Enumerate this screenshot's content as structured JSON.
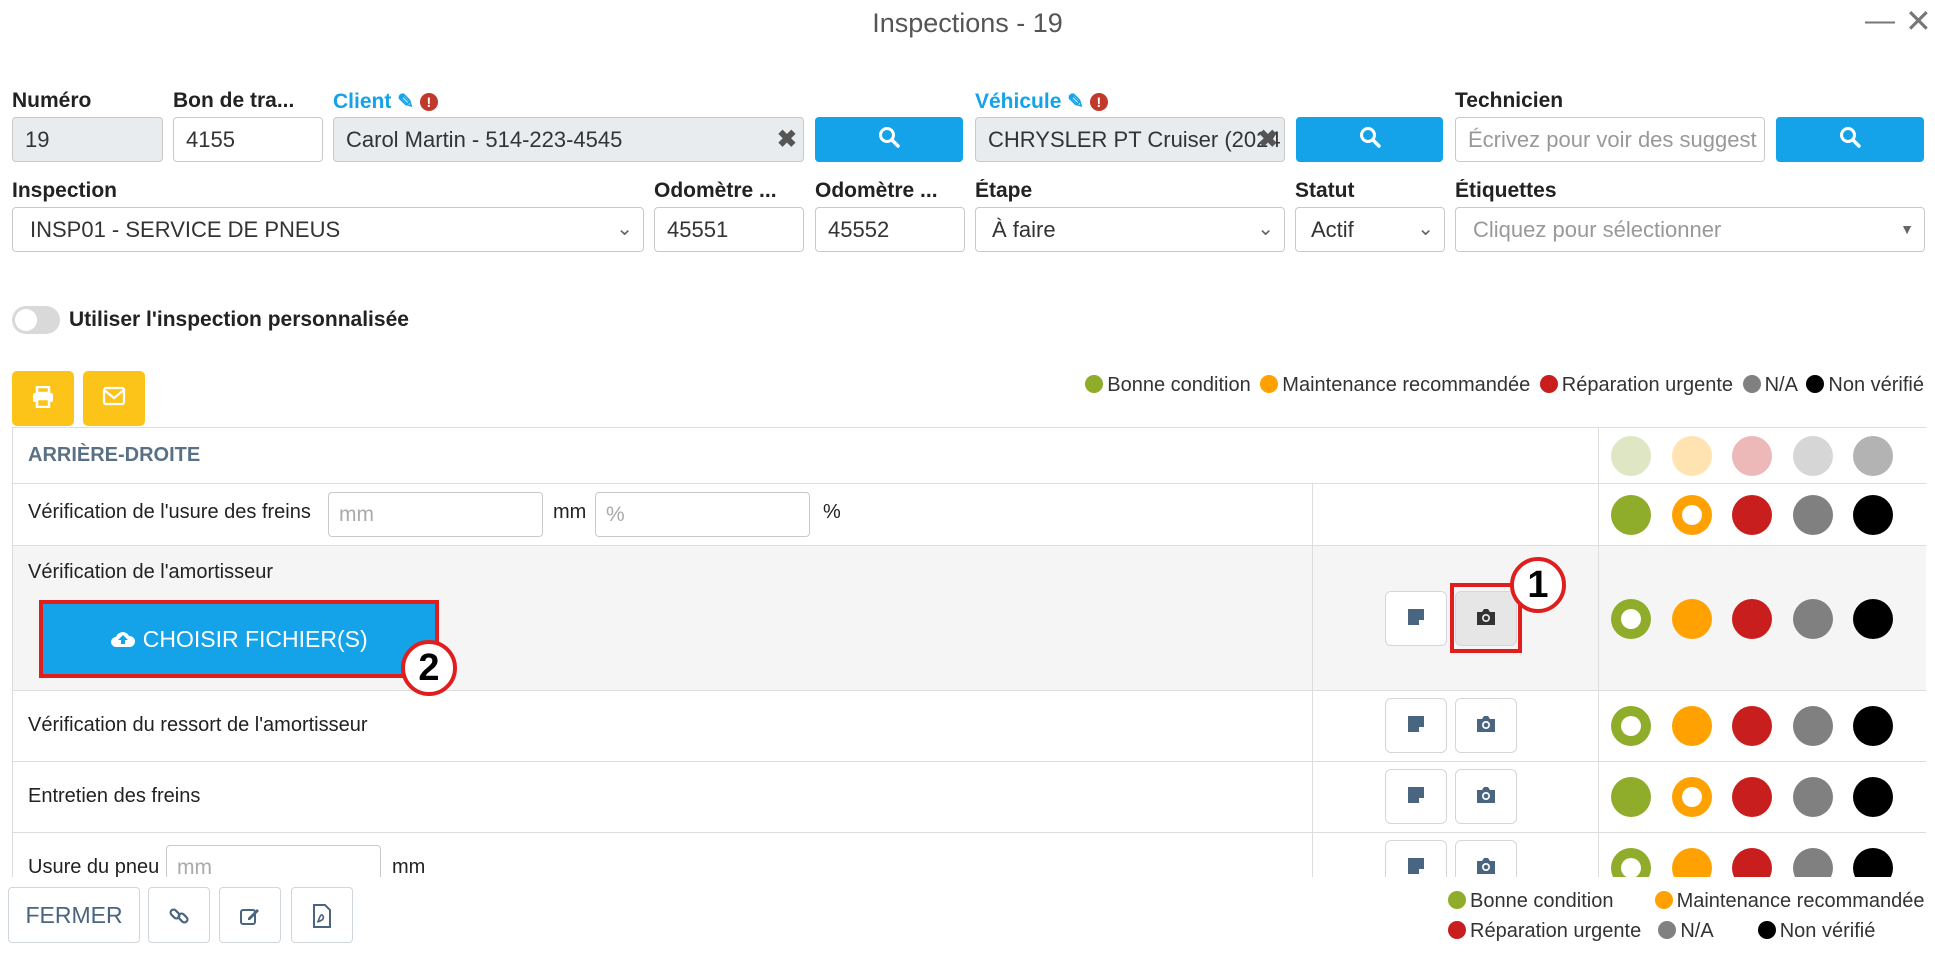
{
  "window": {
    "title": "Inspections - 19",
    "minimize": "—",
    "close": "✕"
  },
  "form": {
    "numero": {
      "label": "Numéro",
      "value": "19"
    },
    "bon": {
      "label": "Bon de tra...",
      "value": "4155"
    },
    "client": {
      "label": "Client",
      "value": "Carol Martin - 514-223-4545"
    },
    "vehicule": {
      "label": "Véhicule",
      "value": "CHRYSLER PT Cruiser (2024"
    },
    "technicien": {
      "label": "Technicien",
      "placeholder": "Écrivez pour voir des suggest"
    },
    "inspection": {
      "label": "Inspection",
      "value": "INSP01 - SERVICE DE PNEUS"
    },
    "odometre1": {
      "label": "Odomètre ...",
      "value": "45551"
    },
    "odometre2": {
      "label": "Odomètre ...",
      "value": "45552"
    },
    "etape": {
      "label": "Étape",
      "value": "À faire"
    },
    "statut": {
      "label": "Statut",
      "value": "Actif"
    },
    "etiquettes": {
      "label": "Étiquettes",
      "placeholder": "Cliquez pour sélectionner"
    }
  },
  "toggle": {
    "label": "Utiliser l'inspection personnalisée"
  },
  "legend": {
    "good": "Bonne condition",
    "maint": "Maintenance recommandée",
    "urgent": "Réparation urgente",
    "na": "N/A",
    "notchecked": "Non vérifié"
  },
  "colors": {
    "good": "#8fac2a",
    "maint": "#ffa100",
    "urgent": "#c81e1e",
    "na": "#808080",
    "notchecked": "#000000",
    "accent": "#14a3e8",
    "warn": "#fcc419"
  },
  "section": {
    "title": "ARRIÈRE-DROITE"
  },
  "rows": [
    {
      "label": "Vérification de l'usure des freins",
      "mm_placeholder": "mm",
      "mm_unit": "mm",
      "pct_placeholder": "%",
      "pct_unit": "%"
    },
    {
      "label": "Vérification de l'amortisseur",
      "upload": "CHOISIR FICHIER(S)"
    },
    {
      "label": "Vérification du ressort de l'amortisseur"
    },
    {
      "label": "Entretien des freins"
    },
    {
      "label": "Usure du pneu",
      "mm_placeholder": "mm",
      "mm_unit": "mm"
    }
  ],
  "badges": {
    "one": "1",
    "two": "2"
  },
  "footer": {
    "close": "FERMER"
  }
}
